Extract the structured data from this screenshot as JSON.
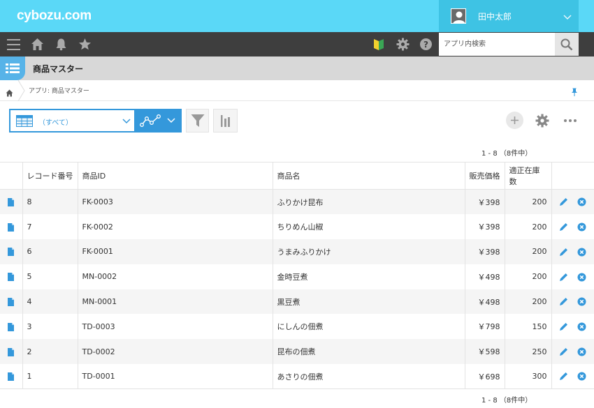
{
  "header": {
    "logo": "cybozu.com",
    "user_name": "田中太郎"
  },
  "toolbar": {
    "icons": [
      "menu-icon",
      "home-icon",
      "bell-icon",
      "star-icon",
      "beginner-icon",
      "gear-icon",
      "help-icon"
    ],
    "search_placeholder": "アプリ内検索"
  },
  "app": {
    "title": "商品マスター",
    "breadcrumb": "アプリ: 商品マスター"
  },
  "view": {
    "selected": "（すべて）"
  },
  "pagination": {
    "top": "1 - 8 （8件中）",
    "bottom": "1 - 8 （8件中）"
  },
  "table": {
    "columns": [
      "レコード番号",
      "商品ID",
      "商品名",
      "販売価格",
      "適正在庫数"
    ],
    "rows": [
      {
        "record_no": "8",
        "product_id": "FK-0003",
        "name": "ふりかけ昆布",
        "price": "￥398",
        "stock": "200"
      },
      {
        "record_no": "7",
        "product_id": "FK-0002",
        "name": "ちりめん山椒",
        "price": "￥398",
        "stock": "200"
      },
      {
        "record_no": "6",
        "product_id": "FK-0001",
        "name": "うまみふりかけ",
        "price": "￥398",
        "stock": "200"
      },
      {
        "record_no": "5",
        "product_id": "MN-0002",
        "name": "金時豆煮",
        "price": "￥498",
        "stock": "200"
      },
      {
        "record_no": "4",
        "product_id": "MN-0001",
        "name": "黒豆煮",
        "price": "￥498",
        "stock": "200"
      },
      {
        "record_no": "3",
        "product_id": "TD-0003",
        "name": "にしんの佃煮",
        "price": "￥798",
        "stock": "150"
      },
      {
        "record_no": "2",
        "product_id": "TD-0002",
        "name": "昆布の佃煮",
        "price": "￥598",
        "stock": "250"
      },
      {
        "record_no": "1",
        "product_id": "TD-0001",
        "name": "あさりの佃煮",
        "price": "￥698",
        "stock": "300"
      }
    ]
  },
  "colors": {
    "header": "#5ad8f7",
    "accent": "#3498db",
    "toolbar": "#3e3e3e"
  }
}
